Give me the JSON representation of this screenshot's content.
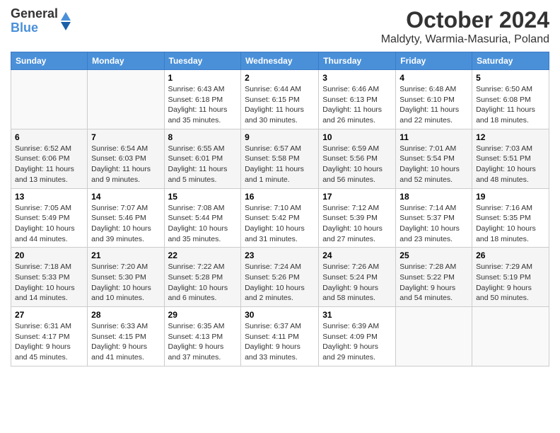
{
  "header": {
    "logo_line1": "General",
    "logo_line2": "Blue",
    "month": "October 2024",
    "location": "Maldyty, Warmia-Masuria, Poland"
  },
  "weekdays": [
    "Sunday",
    "Monday",
    "Tuesday",
    "Wednesday",
    "Thursday",
    "Friday",
    "Saturday"
  ],
  "weeks": [
    [
      {
        "day": "",
        "sunrise": "",
        "sunset": "",
        "daylight": ""
      },
      {
        "day": "",
        "sunrise": "",
        "sunset": "",
        "daylight": ""
      },
      {
        "day": "1",
        "sunrise": "Sunrise: 6:43 AM",
        "sunset": "Sunset: 6:18 PM",
        "daylight": "Daylight: 11 hours and 35 minutes."
      },
      {
        "day": "2",
        "sunrise": "Sunrise: 6:44 AM",
        "sunset": "Sunset: 6:15 PM",
        "daylight": "Daylight: 11 hours and 30 minutes."
      },
      {
        "day": "3",
        "sunrise": "Sunrise: 6:46 AM",
        "sunset": "Sunset: 6:13 PM",
        "daylight": "Daylight: 11 hours and 26 minutes."
      },
      {
        "day": "4",
        "sunrise": "Sunrise: 6:48 AM",
        "sunset": "Sunset: 6:10 PM",
        "daylight": "Daylight: 11 hours and 22 minutes."
      },
      {
        "day": "5",
        "sunrise": "Sunrise: 6:50 AM",
        "sunset": "Sunset: 6:08 PM",
        "daylight": "Daylight: 11 hours and 18 minutes."
      }
    ],
    [
      {
        "day": "6",
        "sunrise": "Sunrise: 6:52 AM",
        "sunset": "Sunset: 6:06 PM",
        "daylight": "Daylight: 11 hours and 13 minutes."
      },
      {
        "day": "7",
        "sunrise": "Sunrise: 6:54 AM",
        "sunset": "Sunset: 6:03 PM",
        "daylight": "Daylight: 11 hours and 9 minutes."
      },
      {
        "day": "8",
        "sunrise": "Sunrise: 6:55 AM",
        "sunset": "Sunset: 6:01 PM",
        "daylight": "Daylight: 11 hours and 5 minutes."
      },
      {
        "day": "9",
        "sunrise": "Sunrise: 6:57 AM",
        "sunset": "Sunset: 5:58 PM",
        "daylight": "Daylight: 11 hours and 1 minute."
      },
      {
        "day": "10",
        "sunrise": "Sunrise: 6:59 AM",
        "sunset": "Sunset: 5:56 PM",
        "daylight": "Daylight: 10 hours and 56 minutes."
      },
      {
        "day": "11",
        "sunrise": "Sunrise: 7:01 AM",
        "sunset": "Sunset: 5:54 PM",
        "daylight": "Daylight: 10 hours and 52 minutes."
      },
      {
        "day": "12",
        "sunrise": "Sunrise: 7:03 AM",
        "sunset": "Sunset: 5:51 PM",
        "daylight": "Daylight: 10 hours and 48 minutes."
      }
    ],
    [
      {
        "day": "13",
        "sunrise": "Sunrise: 7:05 AM",
        "sunset": "Sunset: 5:49 PM",
        "daylight": "Daylight: 10 hours and 44 minutes."
      },
      {
        "day": "14",
        "sunrise": "Sunrise: 7:07 AM",
        "sunset": "Sunset: 5:46 PM",
        "daylight": "Daylight: 10 hours and 39 minutes."
      },
      {
        "day": "15",
        "sunrise": "Sunrise: 7:08 AM",
        "sunset": "Sunset: 5:44 PM",
        "daylight": "Daylight: 10 hours and 35 minutes."
      },
      {
        "day": "16",
        "sunrise": "Sunrise: 7:10 AM",
        "sunset": "Sunset: 5:42 PM",
        "daylight": "Daylight: 10 hours and 31 minutes."
      },
      {
        "day": "17",
        "sunrise": "Sunrise: 7:12 AM",
        "sunset": "Sunset: 5:39 PM",
        "daylight": "Daylight: 10 hours and 27 minutes."
      },
      {
        "day": "18",
        "sunrise": "Sunrise: 7:14 AM",
        "sunset": "Sunset: 5:37 PM",
        "daylight": "Daylight: 10 hours and 23 minutes."
      },
      {
        "day": "19",
        "sunrise": "Sunrise: 7:16 AM",
        "sunset": "Sunset: 5:35 PM",
        "daylight": "Daylight: 10 hours and 18 minutes."
      }
    ],
    [
      {
        "day": "20",
        "sunrise": "Sunrise: 7:18 AM",
        "sunset": "Sunset: 5:33 PM",
        "daylight": "Daylight: 10 hours and 14 minutes."
      },
      {
        "day": "21",
        "sunrise": "Sunrise: 7:20 AM",
        "sunset": "Sunset: 5:30 PM",
        "daylight": "Daylight: 10 hours and 10 minutes."
      },
      {
        "day": "22",
        "sunrise": "Sunrise: 7:22 AM",
        "sunset": "Sunset: 5:28 PM",
        "daylight": "Daylight: 10 hours and 6 minutes."
      },
      {
        "day": "23",
        "sunrise": "Sunrise: 7:24 AM",
        "sunset": "Sunset: 5:26 PM",
        "daylight": "Daylight: 10 hours and 2 minutes."
      },
      {
        "day": "24",
        "sunrise": "Sunrise: 7:26 AM",
        "sunset": "Sunset: 5:24 PM",
        "daylight": "Daylight: 9 hours and 58 minutes."
      },
      {
        "day": "25",
        "sunrise": "Sunrise: 7:28 AM",
        "sunset": "Sunset: 5:22 PM",
        "daylight": "Daylight: 9 hours and 54 minutes."
      },
      {
        "day": "26",
        "sunrise": "Sunrise: 7:29 AM",
        "sunset": "Sunset: 5:19 PM",
        "daylight": "Daylight: 9 hours and 50 minutes."
      }
    ],
    [
      {
        "day": "27",
        "sunrise": "Sunrise: 6:31 AM",
        "sunset": "Sunset: 4:17 PM",
        "daylight": "Daylight: 9 hours and 45 minutes."
      },
      {
        "day": "28",
        "sunrise": "Sunrise: 6:33 AM",
        "sunset": "Sunset: 4:15 PM",
        "daylight": "Daylight: 9 hours and 41 minutes."
      },
      {
        "day": "29",
        "sunrise": "Sunrise: 6:35 AM",
        "sunset": "Sunset: 4:13 PM",
        "daylight": "Daylight: 9 hours and 37 minutes."
      },
      {
        "day": "30",
        "sunrise": "Sunrise: 6:37 AM",
        "sunset": "Sunset: 4:11 PM",
        "daylight": "Daylight: 9 hours and 33 minutes."
      },
      {
        "day": "31",
        "sunrise": "Sunrise: 6:39 AM",
        "sunset": "Sunset: 4:09 PM",
        "daylight": "Daylight: 9 hours and 29 minutes."
      },
      {
        "day": "",
        "sunrise": "",
        "sunset": "",
        "daylight": ""
      },
      {
        "day": "",
        "sunrise": "",
        "sunset": "",
        "daylight": ""
      }
    ]
  ]
}
